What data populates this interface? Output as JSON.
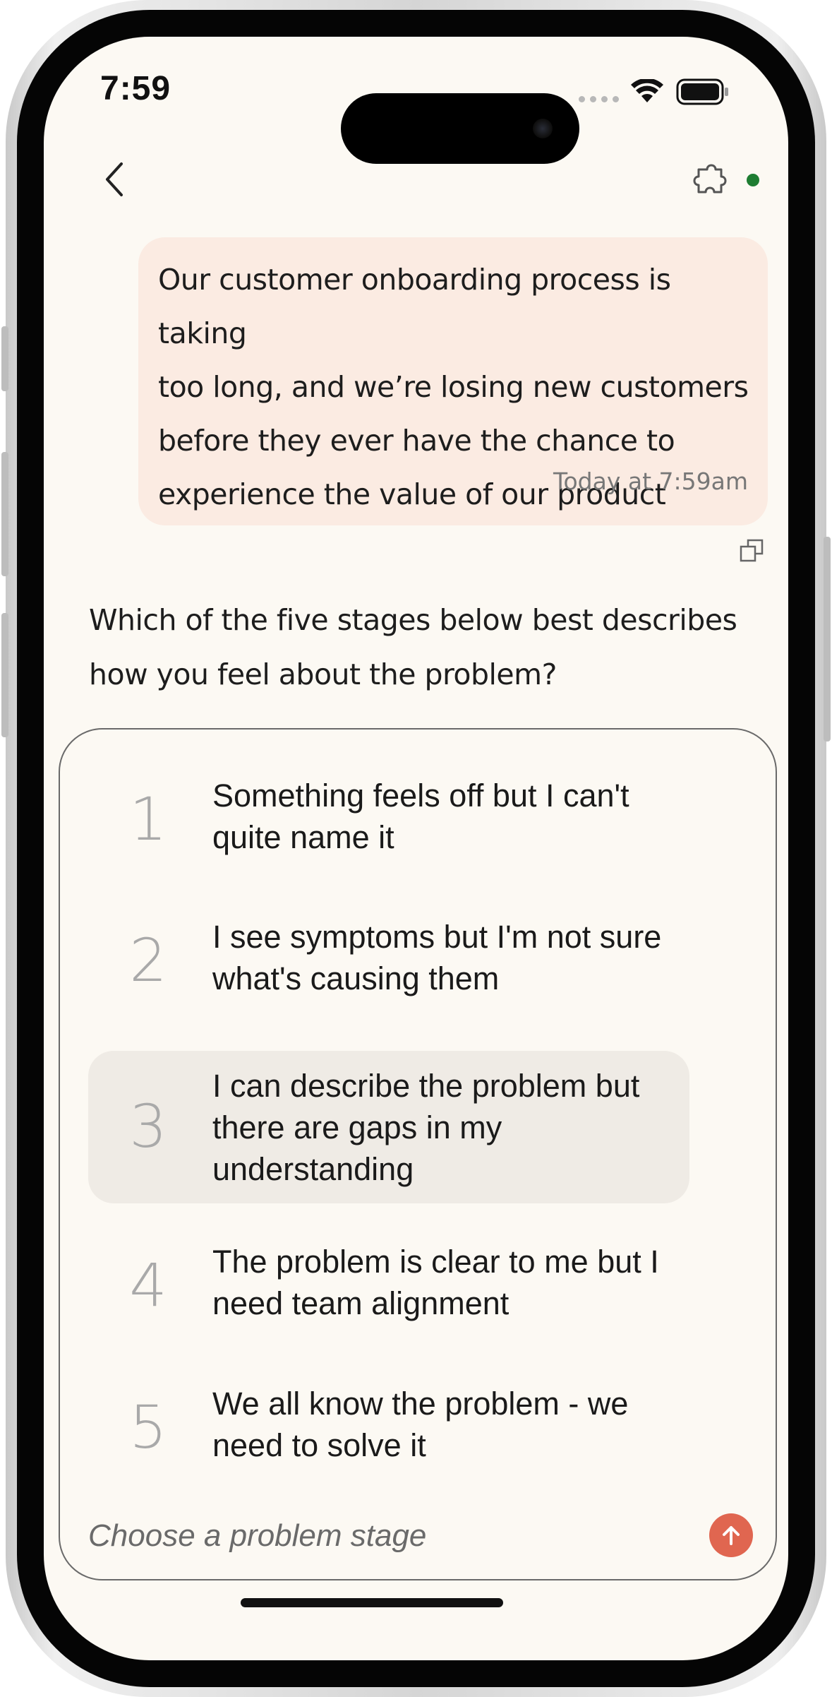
{
  "status_bar": {
    "time": "7:59"
  },
  "header": {
    "back_icon": "chevron-left-icon",
    "plugin_icon": "puzzle-icon",
    "status_color": "#1e7d32"
  },
  "user_message": {
    "lines": [
      "Our customer onboarding process is taking",
      "too long, and we’re losing new customers",
      "before they ever have the chance to",
      "experience the value of our product"
    ],
    "timestamp": "Today at 7:59am",
    "bubble_color": "#fbebe2"
  },
  "assistant": {
    "question_lines": [
      "Which of the five stages below best describes",
      "how you feel about the problem?"
    ]
  },
  "stages": {
    "options": [
      {
        "number": "1",
        "lines": [
          "Something feels off but I can't",
          "quite name it"
        ]
      },
      {
        "number": "2",
        "lines": [
          "I see symptoms but I'm not sure",
          "what's causing them"
        ]
      },
      {
        "number": "3",
        "lines": [
          "I can describe the problem but",
          "there are gaps in my",
          "understanding"
        ],
        "selected": true
      },
      {
        "number": "4",
        "lines": [
          "The problem is clear to me but I",
          "need team alignment"
        ]
      },
      {
        "number": "5",
        "lines": [
          "We all know the problem - we",
          "need to solve it"
        ]
      }
    ],
    "input_placeholder": "Choose a problem stage",
    "send_color": "#e06650"
  }
}
